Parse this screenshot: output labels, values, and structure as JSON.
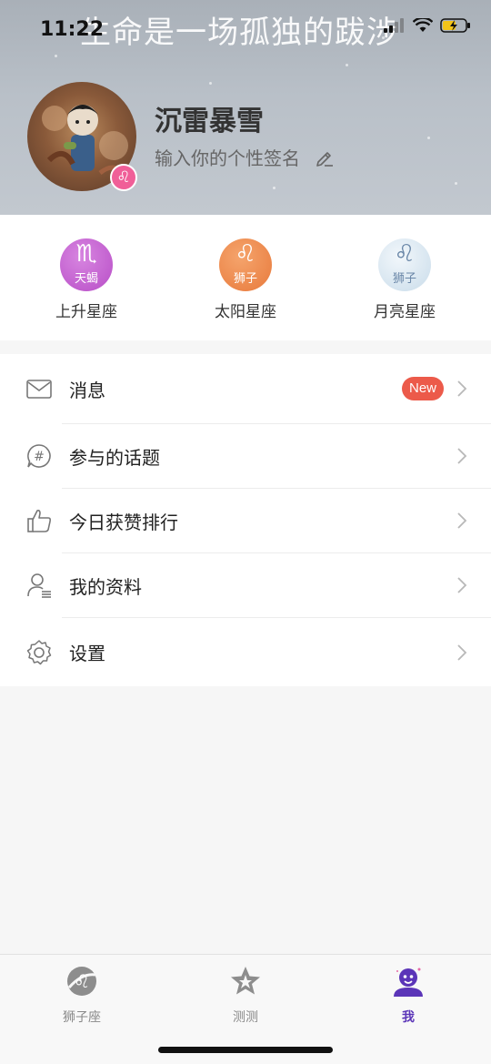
{
  "status_bar": {
    "time": "11:22"
  },
  "header": {
    "banner_text": "生命是一场孤独的跋涉",
    "username": "沉雷暴雪",
    "signature_placeholder": "输入你的个性签名",
    "avatar_badge_glyph": "♌︎"
  },
  "zodiac": [
    {
      "label": "上升星座",
      "glyph": "♏︎",
      "sign": "天蝎",
      "color": "#c45fd0"
    },
    {
      "label": "太阳星座",
      "glyph": "♌︎",
      "sign": "狮子",
      "color": "#ee8a4e"
    },
    {
      "label": "月亮星座",
      "glyph": "♌︎",
      "sign": "狮子",
      "color": "#dbe8f2"
    }
  ],
  "menu": {
    "messages": {
      "label": "消息",
      "badge": "New"
    },
    "topics": {
      "label": "参与的话题"
    },
    "likes": {
      "label": "今日获赞排行"
    },
    "profile": {
      "label": "我的资料"
    },
    "settings": {
      "label": "设置"
    }
  },
  "tabbar": {
    "tabs": [
      {
        "label": "狮子座",
        "icon": "leo-icon"
      },
      {
        "label": "测测",
        "icon": "star-icon"
      },
      {
        "label": "我",
        "icon": "me-icon",
        "active": true
      }
    ]
  },
  "colors": {
    "accent": "#5b35b8",
    "badge": "#ec5a4a"
  }
}
